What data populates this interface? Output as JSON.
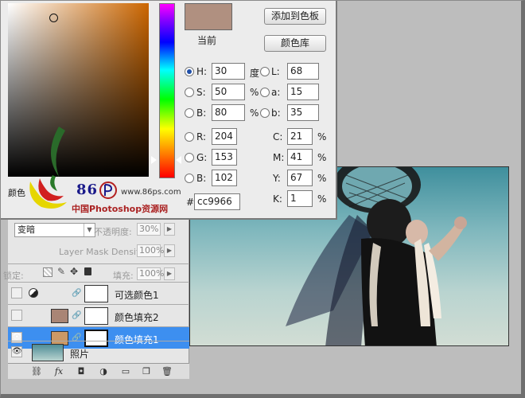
{
  "picker": {
    "current_label": "当前",
    "add_swatch_button": "添加到色板",
    "color_library_button": "颜色库",
    "current_color": "#b09080",
    "hsb": {
      "h_label": "H:",
      "h_value": "30",
      "h_unit": "度",
      "s_label": "S:",
      "s_value": "50",
      "s_unit": "%",
      "b_label": "B:",
      "b_value": "80",
      "b_unit": "%"
    },
    "lab": {
      "l_label": "L:",
      "l_value": "68",
      "a_label": "a:",
      "a_value": "15",
      "b_label": "b:",
      "b_value": "35"
    },
    "rgb": {
      "r_label": "R:",
      "r_value": "204",
      "g_label": "G:",
      "g_value": "153",
      "b_label": "B:",
      "b_value": "102"
    },
    "cmyk": {
      "c_label": "C:",
      "c_value": "21",
      "c_unit": "%",
      "m_label": "M:",
      "m_value": "41",
      "m_unit": "%",
      "y_label": "Y:",
      "y_value": "67",
      "y_unit": "%",
      "k_label": "K:",
      "k_value": "1",
      "k_unit": "%"
    },
    "hex_label": "#",
    "hex_value": "cc9966",
    "selected_mode": "H"
  },
  "watermark": {
    "partial_text": "颜色",
    "brand": "86",
    "url": "www.86ps.com",
    "name": "中国Photoshop资源网"
  },
  "layers": {
    "blend_mode": "变暗",
    "opacity_label": "不透明度:",
    "opacity_value": "30%",
    "mask_density_label": "Layer Mask Density",
    "mask_density_value": "100%",
    "lock_label": "锁定:",
    "fill_label": "填充:",
    "fill_value": "100%",
    "items": [
      {
        "name": "可选颜色1",
        "visible": false,
        "selected": false,
        "thumb_color": "#ffffff"
      },
      {
        "name": "颜色填充2",
        "visible": false,
        "selected": false,
        "thumb_color": "#a98575"
      },
      {
        "name": "颜色填充1",
        "visible": true,
        "selected": true,
        "thumb_color": "#cc9966"
      },
      {
        "name": "照片",
        "visible": true,
        "selected": false,
        "thumb_color": "#4e8d97"
      }
    ],
    "footer_icons": [
      "link-icon",
      "fx-icon",
      "mask-icon",
      "adjustment-icon",
      "group-folder-icon",
      "new-layer-icon",
      "trash-icon"
    ]
  }
}
